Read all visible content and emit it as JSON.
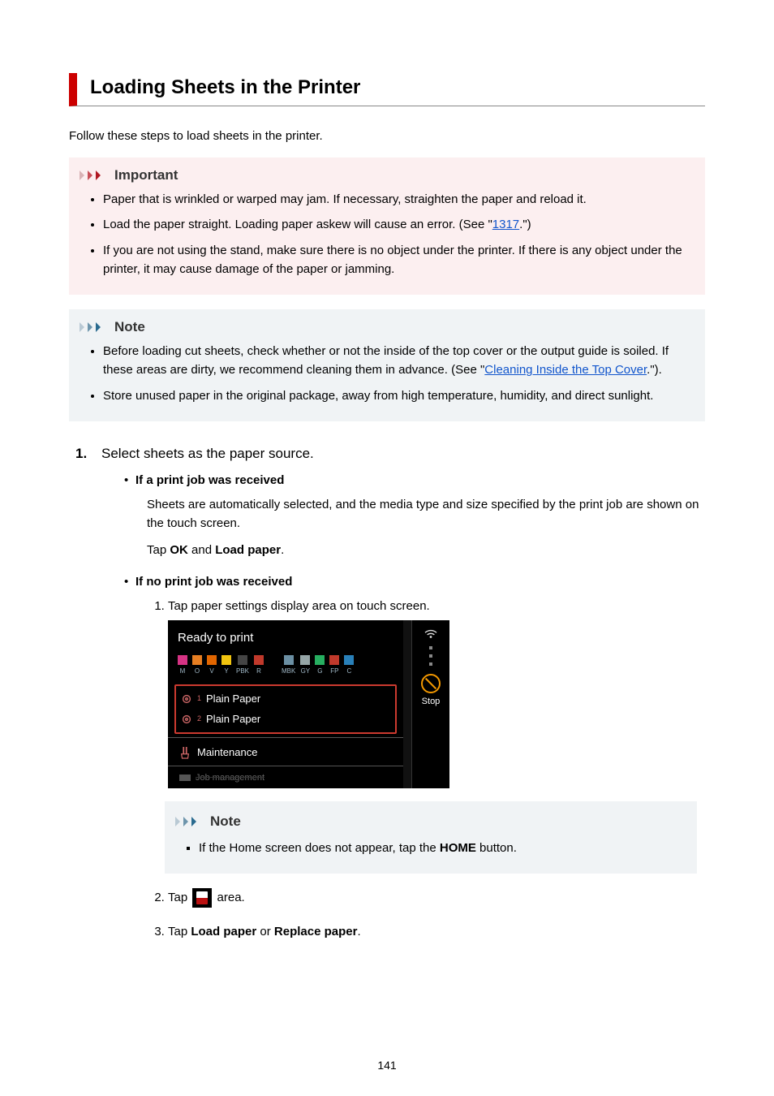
{
  "title": "Loading Sheets in the Printer",
  "intro": "Follow these steps to load sheets in the printer.",
  "important": {
    "heading": "Important",
    "items": [
      {
        "text_before": "Paper that is wrinkled or warped may jam. If necessary, straighten the paper and reload it."
      },
      {
        "text_before": "Load the paper straight. Loading paper askew will cause an error. (See \"",
        "link": "1317",
        "text_after": ".\")"
      },
      {
        "text_before": "If you are not using the stand, make sure there is no object under the printer. If there is any object under the printer, it may cause damage of the paper or jamming."
      }
    ]
  },
  "note1": {
    "heading": "Note",
    "items": [
      {
        "text_before": "Before loading cut sheets, check whether or not the inside of the top cover or the output guide is soiled. If these areas are dirty, we recommend cleaning them in advance. (See \"",
        "link": "Cleaning Inside the Top Cover",
        "text_after": ".\")."
      },
      {
        "text_before": "Store unused paper in the original package, away from high temperature, humidity, and direct sunlight."
      }
    ]
  },
  "step1": {
    "number": "1.",
    "title": "Select sheets as the paper source.",
    "caseA": {
      "title": "If a print job was received",
      "para1": "Sheets are automatically selected, and the media type and size specified by the print job are shown on the touch screen.",
      "para2_pre": "Tap ",
      "para2_b1": "OK",
      "para2_mid": " and ",
      "para2_b2": "Load paper",
      "para2_post": "."
    },
    "caseB": {
      "title": "If no print job was received",
      "sub1": "Tap paper settings display area on touch screen.",
      "sub2_pre": "Tap ",
      "sub2_post": " area.",
      "sub3_pre": "Tap ",
      "sub3_b1": "Load paper",
      "sub3_mid": " or ",
      "sub3_b2": "Replace paper",
      "sub3_post": "."
    }
  },
  "note2": {
    "heading": "Note",
    "item_pre": "If the Home screen does not appear, tap the ",
    "item_b": "HOME",
    "item_post": " button."
  },
  "screenshot": {
    "status": "Ready to print",
    "inks": [
      {
        "label": "M",
        "color": "#d63384"
      },
      {
        "label": "O",
        "color": "#e67e22"
      },
      {
        "label": "V",
        "color": "#e06500"
      },
      {
        "label": "Y",
        "color": "#f1c40f"
      },
      {
        "label": "PBK",
        "color": "#444444"
      },
      {
        "label": "R",
        "color": "#c0392b"
      },
      {
        "label": "MBK",
        "color": "#6b8fa3"
      },
      {
        "label": "GY",
        "color": "#95a5a6"
      },
      {
        "label": "G",
        "color": "#27ae60"
      },
      {
        "label": "FP",
        "color": "#c0392b"
      },
      {
        "label": "C",
        "color": "#2980b9"
      }
    ],
    "paper1": "Plain Paper",
    "paper2": "Plain Paper",
    "maintenance": "Maintenance",
    "job": "Job management",
    "stop": "Stop"
  },
  "page_number": "141"
}
